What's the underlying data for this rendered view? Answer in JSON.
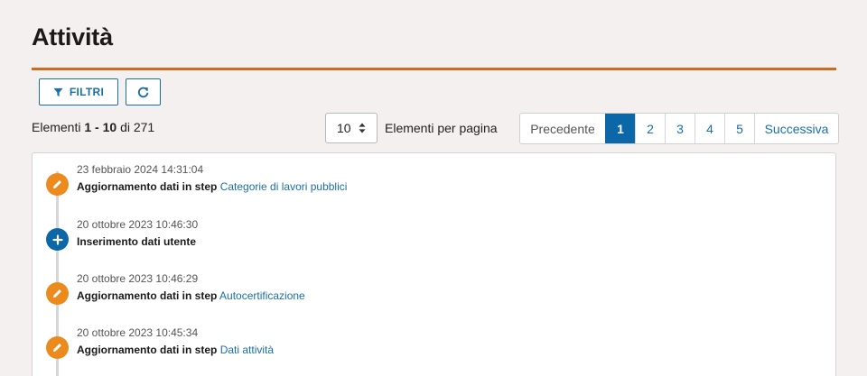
{
  "page": {
    "title": "Attività"
  },
  "toolbar": {
    "filter_label": "FILTRI",
    "refresh_icon": "refresh-icon",
    "filter_icon": "funnel-icon"
  },
  "summary": {
    "prefix": "Elementi",
    "range": "1 - 10",
    "of_word": "di",
    "total": "271"
  },
  "per_page": {
    "value": "10",
    "label": "Elementi per pagina"
  },
  "pagination": {
    "prev": "Precedente",
    "pages": [
      "1",
      "2",
      "3",
      "4",
      "5"
    ],
    "active": "1",
    "next": "Successiva"
  },
  "activities": [
    {
      "type": "edit",
      "date": "23 febbraio 2024 14:31:04",
      "text": "Aggiornamento dati in step",
      "link": "Categorie di lavori pubblici"
    },
    {
      "type": "add",
      "date": "20 ottobre 2023 10:46:30",
      "text": "Inserimento dati utente",
      "link": ""
    },
    {
      "type": "edit",
      "date": "20 ottobre 2023 10:46:29",
      "text": "Aggiornamento dati in step",
      "link": "Autocertificazione"
    },
    {
      "type": "edit",
      "date": "20 ottobre 2023 10:45:34",
      "text": "Aggiornamento dati in step",
      "link": "Dati attività"
    }
  ],
  "colors": {
    "accent": "#d2691e",
    "primary": "#0c67a8",
    "edit": "#ec8a1d"
  }
}
